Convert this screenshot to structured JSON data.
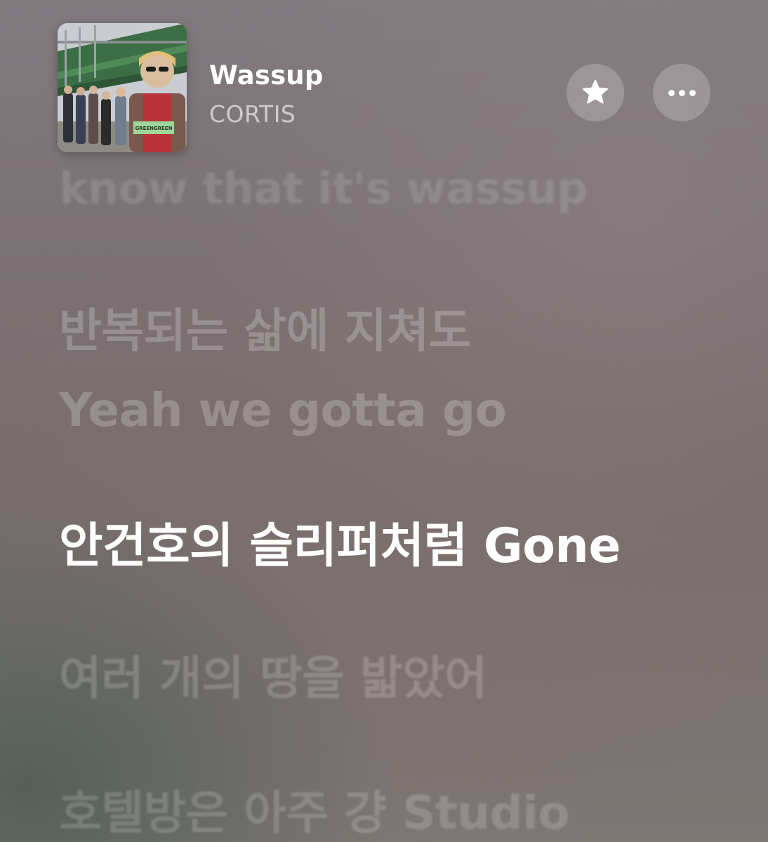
{
  "now_playing": {
    "title": "Wassup",
    "artist": "CORTIS",
    "artwork": {
      "description_icon": "album-artwork",
      "sticker_text": "GREENGREEN"
    }
  },
  "actions": {
    "favorite_icon": "star-icon",
    "more_icon": "more-icon"
  },
  "lyrics": [
    {
      "text": "know that it's wassup",
      "state": "past"
    },
    {
      "text": "반복되는 삶에 지쳐도",
      "state": "upcoming"
    },
    {
      "text": "Yeah we gotta go",
      "state": "upcoming"
    },
    {
      "text": "안건호의 슬리퍼처럼 Gone",
      "state": "current"
    },
    {
      "text": "여러 개의 땅을 밟았어",
      "state": "upcoming"
    },
    {
      "text": "호텔방은 아주 걍 Studio",
      "state": "upcoming"
    }
  ]
}
